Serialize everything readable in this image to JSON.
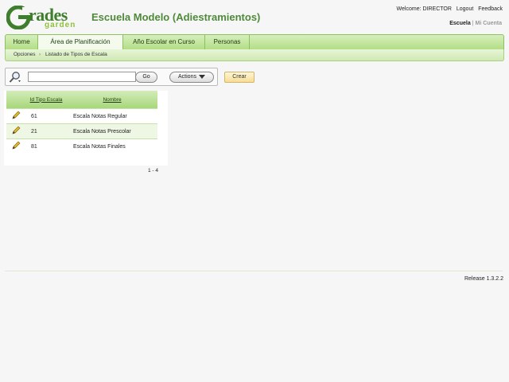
{
  "header": {
    "logo": {
      "word": "rades",
      "sub": "garden"
    },
    "app_title": "Escuela Modelo (Adiestramientos)",
    "welcome": "Welcome: DIRECTOR",
    "logout": "Logout",
    "feedback": "Feedback",
    "ctx_active": "Escuela",
    "ctx_sep": "|",
    "ctx_other": "Mi Cuenta"
  },
  "tabs": [
    {
      "label": "Home"
    },
    {
      "label": "Área de Planificación"
    },
    {
      "label": "Año Escolar en Curso"
    },
    {
      "label": "Personas"
    }
  ],
  "breadcrumb": {
    "parent": "Opciones",
    "current": "Listado de Tipos de Escala"
  },
  "search": {
    "value": "",
    "go": "Go",
    "actions": "Actions",
    "create": "Crear"
  },
  "report": {
    "columns": [
      "Id Tipo Escala",
      "Nombre"
    ],
    "rows": [
      {
        "id": "61",
        "name": "Escala Notas Regular"
      },
      {
        "id": "21",
        "name": "Escala Notas Prescolar"
      },
      {
        "id": "81",
        "name": "Escala Notas Finales"
      }
    ],
    "pagination": "1 - 4"
  },
  "footer": {
    "release": "Release 1.3.2.2"
  },
  "colors": {
    "accent": "#4e8a3a",
    "tab_bg": "#b3de86",
    "create_btn": "#f7dd95"
  },
  "icons": [
    "grades-logo-icon",
    "search-icon",
    "dropdown-icon",
    "edit-pencil-icon"
  ]
}
